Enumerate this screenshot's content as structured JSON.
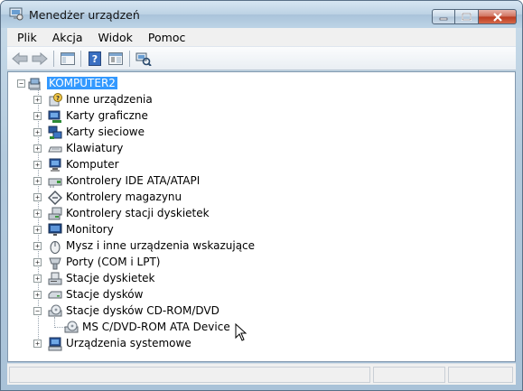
{
  "window": {
    "title": "Menedżer urządzeń",
    "controls": {
      "minimize": "minimize-icon",
      "maximize": "maximize-icon",
      "close": "close-icon"
    }
  },
  "menu": [
    "Plik",
    "Akcja",
    "Widok",
    "Pomoc"
  ],
  "toolbar": {
    "buttons": [
      "back-arrow-icon",
      "forward-arrow-icon",
      "show-hide-console-tree-icon",
      "help-icon",
      "properties-icon",
      "scan-hardware-changes-icon"
    ]
  },
  "tree": {
    "root": {
      "label": "KOMPUTER2",
      "expanded": true,
      "selected": true
    },
    "categories": [
      {
        "label": "Inne urządzenia",
        "icon": "unknown-device-icon",
        "expanded": false
      },
      {
        "label": "Karty graficzne",
        "icon": "display-adapter-icon",
        "expanded": false
      },
      {
        "label": "Karty sieciowe",
        "icon": "network-adapter-icon",
        "expanded": false
      },
      {
        "label": "Klawiatury",
        "icon": "keyboard-icon",
        "expanded": false
      },
      {
        "label": "Komputer",
        "icon": "computer-icon",
        "expanded": false
      },
      {
        "label": "Kontrolery IDE ATA/ATAPI",
        "icon": "ide-controller-icon",
        "expanded": false
      },
      {
        "label": "Kontrolery magazynu",
        "icon": "storage-controller-icon",
        "expanded": false
      },
      {
        "label": "Kontrolery stacji dyskietek",
        "icon": "floppy-controller-icon",
        "expanded": false
      },
      {
        "label": "Monitory",
        "icon": "monitor-icon",
        "expanded": false
      },
      {
        "label": "Mysz i inne urządzenia wskazujące",
        "icon": "mouse-icon",
        "expanded": false
      },
      {
        "label": "Porty (COM i LPT)",
        "icon": "port-icon",
        "expanded": false
      },
      {
        "label": "Stacje dyskietek",
        "icon": "floppy-drive-icon",
        "expanded": false
      },
      {
        "label": "Stacje dysków",
        "icon": "disk-drive-icon",
        "expanded": false
      },
      {
        "label": "Stacje dysków CD-ROM/DVD",
        "icon": "cdrom-drive-icon",
        "expanded": true,
        "children": [
          {
            "label": "MS C/DVD-ROM ATA Device",
            "icon": "cdrom-device-icon"
          }
        ]
      },
      {
        "label": "Urządzenia systemowe",
        "icon": "system-devices-icon",
        "expanded": false
      }
    ]
  },
  "colors": {
    "selection": "#3399ff",
    "titlebar": "#bcd2e4",
    "close_button": "#c7472a"
  }
}
